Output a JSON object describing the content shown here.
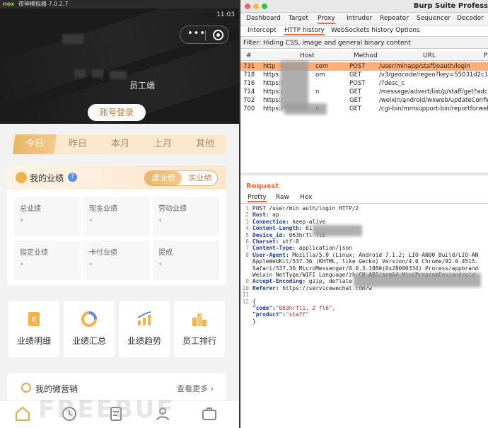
{
  "emulator": {
    "title": "夜神模拟器 7.0.2.7",
    "nox_logo": "nox",
    "status_time": "11:03",
    "staff_suffix": "员工端",
    "login_button": "账号登录",
    "period_tabs": [
      "今日",
      "昨日",
      "本月",
      "上月",
      "其他"
    ],
    "performance": {
      "title": "我的业绩",
      "help": "?",
      "toggle": [
        "虚业绩",
        "实业绩"
      ],
      "cells": [
        {
          "label": "总业绩",
          "value": "*"
        },
        {
          "label": "现金业绩",
          "value": "*"
        },
        {
          "label": "劳动业绩",
          "value": "*"
        },
        {
          "label": "指定业绩",
          "value": "*"
        },
        {
          "label": "卡付业绩",
          "value": "*"
        },
        {
          "label": "提成",
          "value": "*"
        }
      ]
    },
    "quick_links": [
      "业绩明细",
      "业绩汇总",
      "业绩趋势",
      "员工排行"
    ],
    "micro_marketing": {
      "title": "我的微营销",
      "more": "查看更多 ›"
    },
    "watermark": "FREEBUF",
    "colors": {
      "gold": "#e7b66a",
      "dark": "#1b1b1b"
    }
  },
  "burp": {
    "app_title": "Burp Suite Profess",
    "menu_tabs": [
      "Dashboard",
      "Target",
      "Proxy",
      "Intruder",
      "Repeater",
      "Sequencer",
      "Decoder"
    ],
    "active_menu": "Proxy",
    "sub_tabs": [
      "Intercept",
      "HTTP history",
      "WebSockets history",
      "Options"
    ],
    "active_sub": "HTTP history",
    "filter_text": "Filter: Hiding CSS, image and general binary content",
    "columns": [
      "#",
      "Host",
      "Method",
      "URL",
      "P"
    ],
    "rows": [
      {
        "num": "731",
        "host": "http",
        "host_tail": "com",
        "method": "POST",
        "url": "/user/minapp/staff/oauth/login",
        "selected": true
      },
      {
        "num": "718",
        "host": "https",
        "host_tail": "om",
        "method": "GET",
        "url": "/v3/geocode/regeo?key=55031d2c1d...",
        "selected": false
      },
      {
        "num": "716",
        "host": "https:/",
        "host_tail": "",
        "method": "POST",
        "url": "/?desc_c",
        "selected": false
      },
      {
        "num": "714",
        "host": "https:/",
        "host_tail": "n",
        "method": "GET",
        "url": "/message/advert/list/p/staff/get?adco...",
        "selected": false
      },
      {
        "num": "702",
        "host": "https:/",
        "host_tail": "",
        "method": "GET",
        "url": "/weixin/android/wxweb/updateConfig...",
        "selected": false
      },
      {
        "num": "700",
        "host": "https:/",
        "host_tail": "n",
        "method": "GET",
        "url": "/cgi-bin/mmsupport-bin/reportforweb...",
        "selected": false
      }
    ],
    "request_label": "Request",
    "request_tabs": [
      "Pretty",
      "Raw",
      "Hex"
    ],
    "active_request_tab": "Pretty",
    "request_lines": [
      {
        "n": "1",
        "key": "",
        "text": "POST /user/min          auth/login HTTP/2"
      },
      {
        "n": "2",
        "key": "Host:",
        "text": " ap"
      },
      {
        "n": "3",
        "key": "Connection:",
        "text": " keep-alive"
      },
      {
        "n": "4",
        "key": "Content-Length:",
        "text": " 61"
      },
      {
        "n": "5",
        "key": "Device_id:",
        "text": " 063hrfl                    fl6"
      },
      {
        "n": "6",
        "key": "Charset:",
        "text": " utf-8"
      },
      {
        "n": "7",
        "key": "Content-Type:",
        "text": " application/json"
      },
      {
        "n": "8",
        "key": "User-Agent:",
        "text": " Mozilla/5.0 (Linux; Android 7.1.2; LIO-AN00 Build/LIO-AN"
      },
      {
        "n": "",
        "key": "",
        "text": "AppleWebKit/537.36 (KHTML, like Gecko) Version/4.0 Chrome/92.0.4515."
      },
      {
        "n": "",
        "key": "",
        "text": "Safari/537.36 MicroMessenger/8.0.3.1880(0x28000334) Process/appbrand"
      },
      {
        "n": "",
        "key": "",
        "text": "Weixin NetType/WIFI Language/zh_CN ABI/arm64 MiniProgramEnv/android"
      },
      {
        "n": "9",
        "key": "Accept-Encoding:",
        "text": " gzip, deflate"
      },
      {
        "n": "10",
        "key": "Referer:",
        "text": " https://servicewechat.com/w"
      },
      {
        "n": "11",
        "key": "",
        "text": ""
      },
      {
        "n": "12",
        "key": "",
        "text": "{"
      },
      {
        "n": "",
        "key": "  \"code\":",
        "text": "\"063hrfl1,          2        fl6\","
      },
      {
        "n": "",
        "key": "  \"product\":",
        "text": "\"staff\""
      },
      {
        "n": "",
        "key": "",
        "text": "}"
      }
    ]
  }
}
